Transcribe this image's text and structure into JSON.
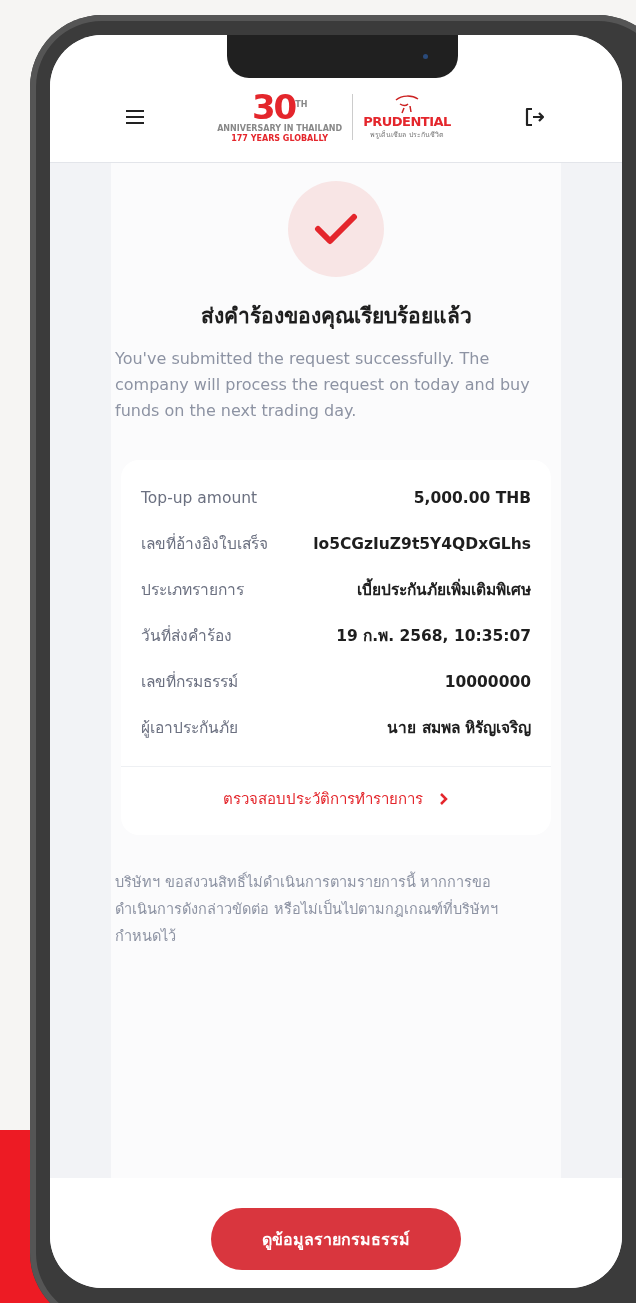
{
  "header": {
    "logo": {
      "anniversary_number": "30$^{TH}$",
      "anniversary_line": "ANNIVERSARY IN THAILAND",
      "years_line": "177 YEARS GLOBALLY",
      "brand": "PRUDENTIAL",
      "brand_thai": "พรูเด็นเชียล ประกันชีวิต"
    }
  },
  "success": {
    "title": "ส่งคำร้องของคุณเรียบร้อยแล้ว",
    "message": "You've submitted the request successfully. The company will process the request on today and buy funds on the next trading day."
  },
  "details": [
    {
      "label": "Top-up amount",
      "value": "5,000.00 THB"
    },
    {
      "label": "เลขที่อ้างอิงใบเสร็จ",
      "value": "lo5CGzIuZ9t5Y4QDxGLhs"
    },
    {
      "label": "ประเภทรายการ",
      "value": "เบี้ยประกันภัยเพิ่มเติมพิเศษ"
    },
    {
      "label": "วันที่ส่งคำร้อง",
      "value": "19 ก.พ. 2568, 10:35:07"
    },
    {
      "label": "เลขที่กรมธรรม์",
      "value": "10000000"
    },
    {
      "label": "ผู้เอาประกันภัย",
      "value": "นาย สมพล หิรัญเจริญ"
    }
  ],
  "history_link": {
    "label": "ตรวจสอบประวัติการทำรายการ"
  },
  "disclaimer": "บริษัทฯ ขอสงวนสิทธิ์ไม่ดำเนินการตามรายการนี้ หากการขอดำเนินการดังกล่าวขัดต่อ หรือไม่เป็นไปตามกฎเกณฑ์ที่บริษัทฯ กำหนดไว้",
  "primary_button": {
    "label": "ดูข้อมูลรายกรมธรรม์"
  }
}
